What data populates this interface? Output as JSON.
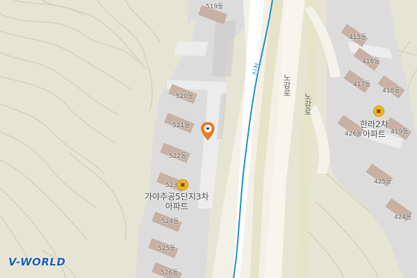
{
  "map": {
    "logo": "V-WORLD",
    "buildings_left": [
      "519동",
      "520동",
      "521동",
      "522동",
      "523동",
      "524동",
      "525동",
      "526동"
    ],
    "buildings_right": [
      "415동",
      "416동",
      "417동",
      "418동",
      "419동",
      "426동",
      "425동",
      "424동"
    ],
    "complexes": [
      {
        "name_line1": "가야주공5단지3차",
        "name_line2": "아파트"
      },
      {
        "name_line1": "한라2차",
        "name_line2": "아파트"
      }
    ],
    "road_label": "노강로",
    "stream_label": "신천",
    "poi_icon": "apartment-icon",
    "marker_icon": "location-pin-icon",
    "colors": {
      "terrain": "#e6e4d2",
      "apartment_area": "#dedede",
      "road": "#f5f3e9",
      "stream": "#1c8fc9",
      "building": "#c7b1a3",
      "marker": "#f07d1c"
    }
  }
}
